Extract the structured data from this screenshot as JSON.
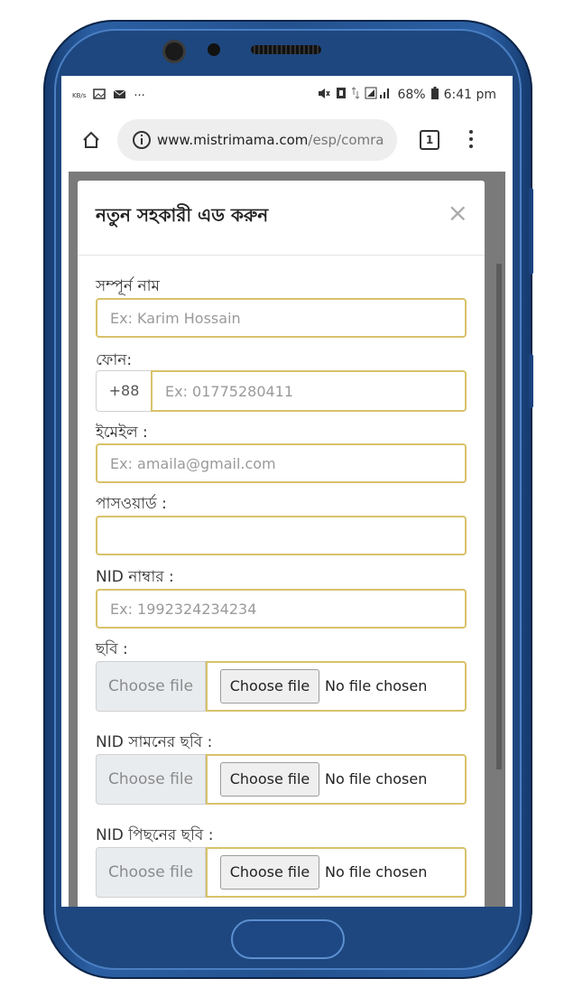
{
  "status_bar": {
    "left_text": "KB/s",
    "dots": "···",
    "battery": "68%",
    "time": "6:41 pm"
  },
  "browser": {
    "url_host": "www.mistrimama.com",
    "url_path": "/esp/comra",
    "tab_count": "1"
  },
  "modal": {
    "title": "নতুন সহকারী এড করুন",
    "close": "×",
    "fields": {
      "full_name_label": "সম্পূর্ন নাম",
      "full_name_placeholder": "Ex: Karim Hossain",
      "phone_label": "ফোন:",
      "phone_prefix": "+88",
      "phone_placeholder": "Ex: 01775280411",
      "email_label": "ইমেইল :",
      "email_placeholder": "Ex: amaila@gmail.com",
      "password_label": "পাসওয়ার্ড :",
      "nid_label": "NID নাম্বার :",
      "nid_placeholder": "Ex: 1992324234234",
      "photo_label": "ছবি :",
      "nid_front_label": "NID সামনের ছবি :",
      "nid_back_label": "NID পিছনের ছবি :"
    },
    "file_inputs": {
      "side_label": "Choose file",
      "button_label": "Choose file",
      "status": "No file chosen"
    }
  }
}
